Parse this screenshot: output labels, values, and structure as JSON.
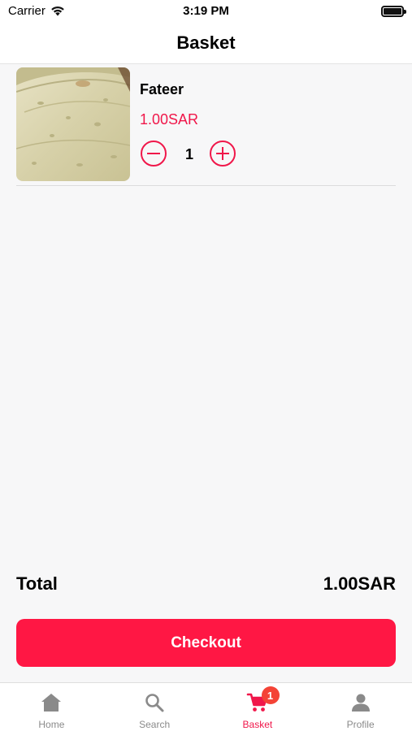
{
  "status_bar": {
    "carrier": "Carrier",
    "time": "3:19 PM"
  },
  "header": {
    "title": "Basket"
  },
  "basket": {
    "items": [
      {
        "name": "Fateer",
        "price": "1.00SAR",
        "quantity": "1",
        "image": "flatbread-photo"
      }
    ]
  },
  "summary": {
    "total_label": "Total",
    "total_value": "1.00SAR"
  },
  "checkout": {
    "label": "Checkout"
  },
  "tabs": [
    {
      "label": "Home",
      "icon": "home-icon",
      "active": false
    },
    {
      "label": "Search",
      "icon": "search-icon",
      "active": false
    },
    {
      "label": "Basket",
      "icon": "cart-icon",
      "active": true,
      "badge": "1"
    },
    {
      "label": "Profile",
      "icon": "person-icon",
      "active": false
    }
  ],
  "colors": {
    "accent": "#ff1744",
    "price": "#f0174a",
    "badge": "#f44336",
    "inactive": "#8a8a8a"
  }
}
